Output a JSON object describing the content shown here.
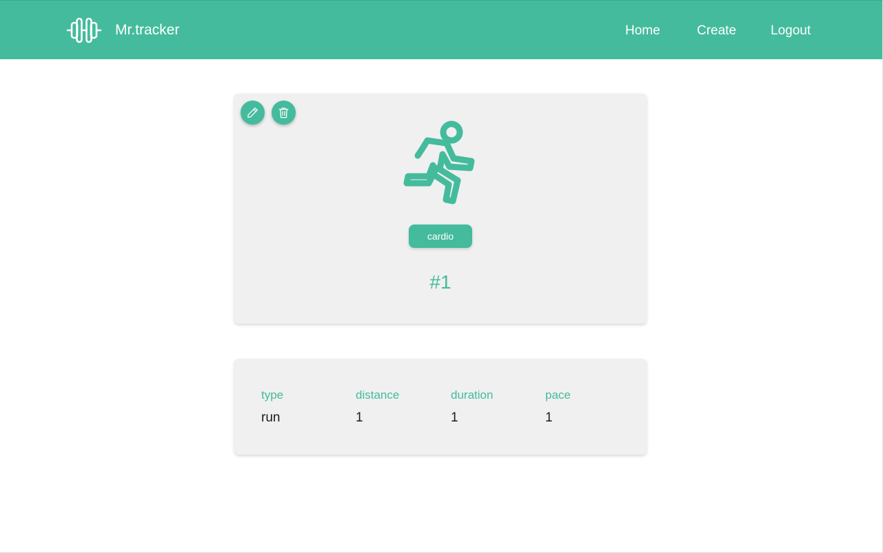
{
  "theme": {
    "accent": "#44bb9c",
    "card_background": "#f0f0f0"
  },
  "navbar": {
    "brand_icon": "dumbbell-icon",
    "brand_name": "Mr.tracker",
    "links": {
      "home": "Home",
      "create": "Create",
      "logout": "Logout"
    }
  },
  "workout": {
    "actions": {
      "edit_icon": "pencil-icon",
      "delete_icon": "trash-icon"
    },
    "activity_icon": "running-person-icon",
    "category": "cardio",
    "number": "#1",
    "details": [
      {
        "label": "type",
        "value": "run"
      },
      {
        "label": "distance",
        "value": "1"
      },
      {
        "label": "duration",
        "value": "1"
      },
      {
        "label": "pace",
        "value": "1"
      }
    ]
  }
}
